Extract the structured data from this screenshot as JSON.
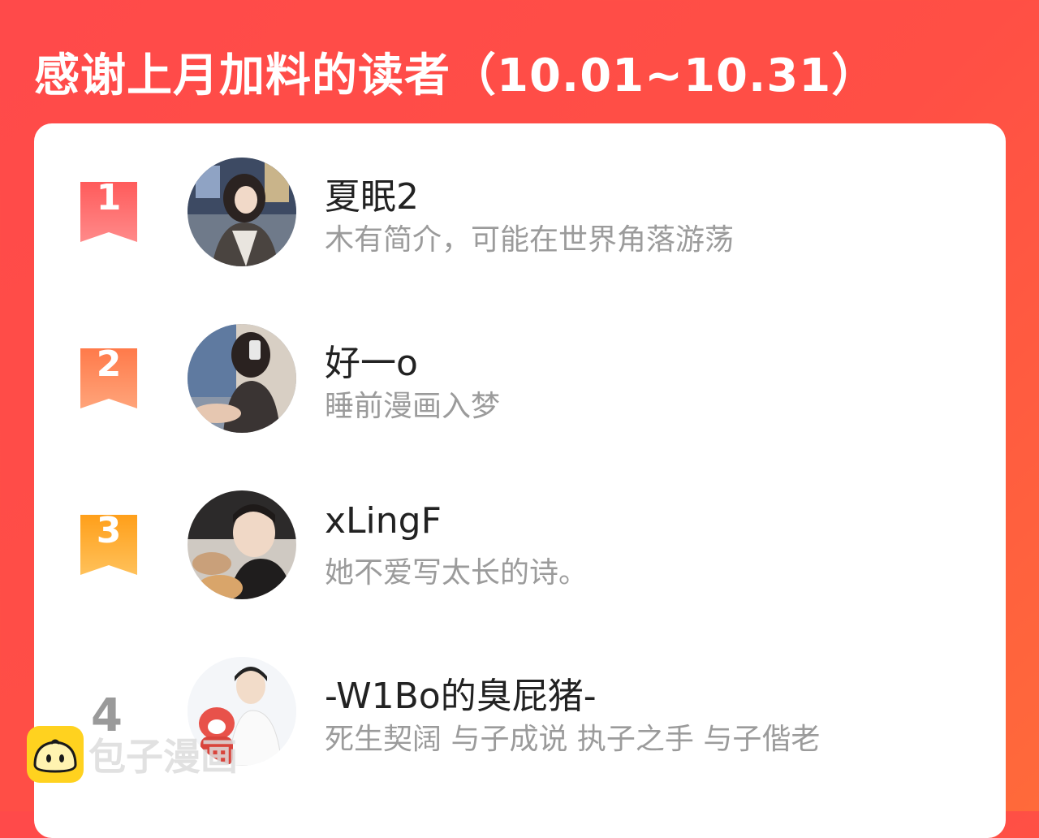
{
  "header": {
    "title": "感谢上月加料的读者（10.01~10.31）"
  },
  "readers": [
    {
      "rank": "1",
      "name": "夏眠2",
      "bio": "木有简介，可能在世界角落游荡",
      "badge_color": "#ff6b6b"
    },
    {
      "rank": "2",
      "name": "好一o",
      "bio": "睡前漫画入梦",
      "badge_color": "#ff8a5c"
    },
    {
      "rank": "3",
      "name": "xLingF",
      "bio": "她不爱写太长的诗。",
      "badge_color": "#ffb02e"
    },
    {
      "rank": "4",
      "name": "-W1Bo的臭屁猪-",
      "bio": "死生契阔 与子成说 执子之手 与子偕老"
    }
  ],
  "watermark": {
    "text": "包子漫画",
    "icon": "bun-face-icon"
  }
}
